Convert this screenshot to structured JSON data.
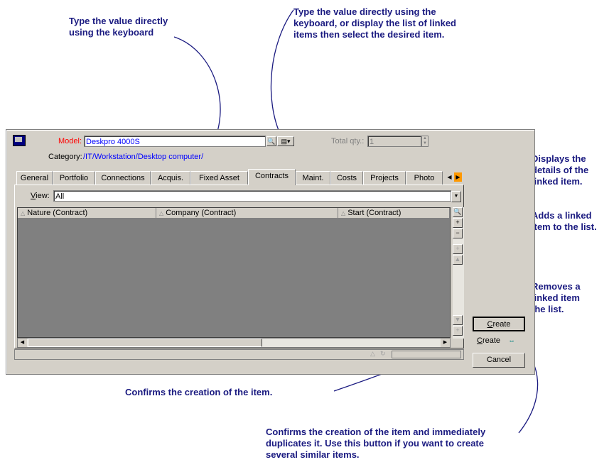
{
  "callouts": {
    "type_directly": "Type the value directly\nusing the keyboard",
    "type_or_list": "Type the value directly using the\nkeyboard, or display the list of linked\nitems then select the desired item.",
    "displays_details": "Displays the\ndetails of the\nlinked item.",
    "adds_linked": "Adds a linked\nitem to the list.",
    "removes_linked": "Removes a\nlinked item\nthe list.",
    "confirms_creation": "Confirms the creation of the item.",
    "confirms_duplicate": "Confirms the creation of the item and immediately\nduplicates it. Use this button if you want to create\nseveral similar items."
  },
  "form": {
    "model_label": "Model:",
    "model_value": "Deskpro 4000S",
    "total_qty_label": "Total qty.:",
    "total_qty_value": "1",
    "category_label": "Category:",
    "category_value": "/IT/Workstation/Desktop computer/"
  },
  "tabs": [
    "General",
    "Portfolio",
    "Connections",
    "Acquis.",
    "Fixed Asset",
    "Contracts",
    "Maint.",
    "Costs",
    "Projects",
    "Photo"
  ],
  "active_tab": "Contracts",
  "view": {
    "label": "View:",
    "value": "All"
  },
  "columns": [
    "Nature (Contract)",
    "Company (Contract)",
    "Start (Contract)"
  ],
  "buttons": {
    "create": "Create",
    "create_dup": "Create",
    "cancel": "Cancel"
  },
  "colors": {
    "callout_text": "#1a1a80",
    "model_label": "#ff0000",
    "link_text": "#0000ff",
    "grid_bg": "#808080"
  }
}
